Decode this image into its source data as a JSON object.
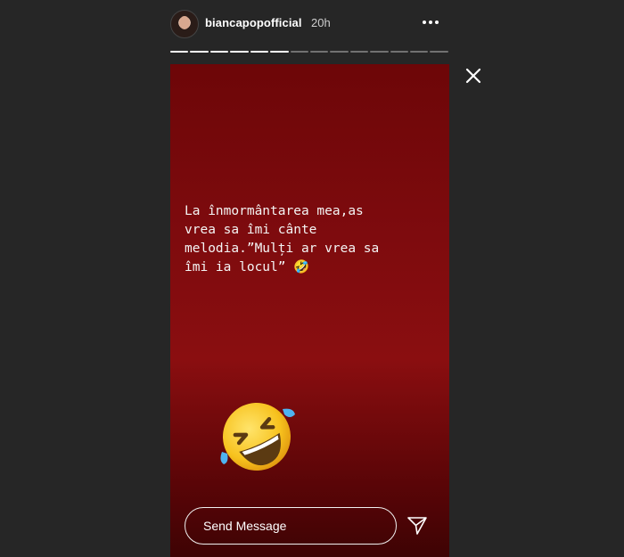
{
  "header": {
    "username": "biancapopofficial",
    "timestamp": "20h",
    "more_icon": "more-horizontal-icon",
    "avatar_icon": "profile-avatar"
  },
  "progress": {
    "total_segments": 14,
    "completed_segments": 6
  },
  "close_icon": "close-icon",
  "story": {
    "text": "La înmormântarea mea,as\nvrea sa îmi cânte\nmelodia.”Mulți ar vrea sa\nîmi ia locul” 🤣",
    "sticker_icon": "rolling-on-floor-laughing-emoji",
    "background_color": "#7e0b0e"
  },
  "reply": {
    "placeholder": "Send Message",
    "send_icon": "paper-plane-icon"
  }
}
